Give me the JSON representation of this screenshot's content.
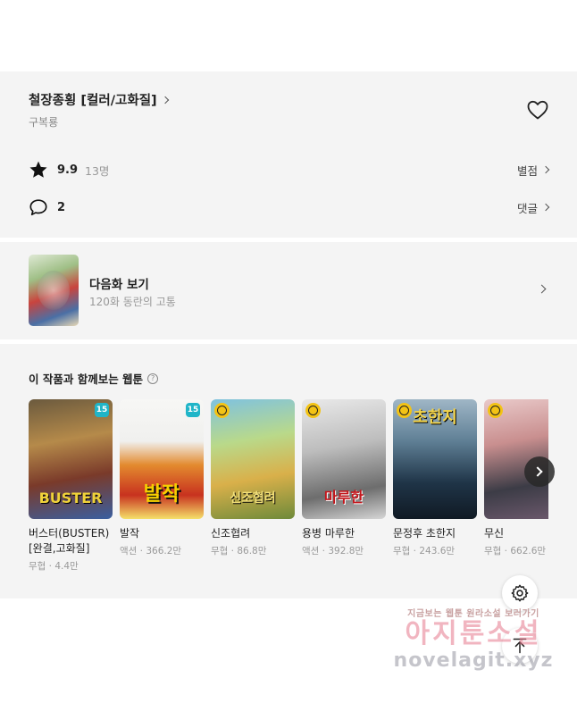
{
  "work": {
    "title": "철장종횡 [컬러/고화질]",
    "author": "구복룡",
    "rating": "9.9",
    "rating_count": "13명",
    "rating_link": "별점",
    "comment_count": "2",
    "comment_link": "댓글"
  },
  "next_episode": {
    "label": "다음화 보기",
    "subtitle": "120화 동란의 고통"
  },
  "recommendations": {
    "title": "이 작품과 함께보는 웹툰",
    "help_icon_text": "?",
    "items": [
      {
        "name": "버스터(BUSTER) [완결,고화질]",
        "meta": "무협 · 4.4만",
        "badge": "15",
        "badge_type": "age",
        "cover_text": "BUSTER"
      },
      {
        "name": "발작",
        "meta": "액션 · 366.2만",
        "badge": "15",
        "badge_type": "age",
        "cover_text": "발작"
      },
      {
        "name": "신조협려",
        "meta": "무협 · 86.8만",
        "badge": "",
        "badge_type": "wait",
        "cover_text": "신조협려"
      },
      {
        "name": "용병 마루한",
        "meta": "액션 · 392.8만",
        "badge": "",
        "badge_type": "wait",
        "cover_text": "마루한"
      },
      {
        "name": "문정후 초한지",
        "meta": "무협 · 243.6만",
        "badge": "",
        "badge_type": "wait",
        "cover_text": "초한지"
      },
      {
        "name": "무신",
        "meta": "무협 · 662.6만",
        "badge": "",
        "badge_type": "wait",
        "cover_text": ""
      }
    ]
  },
  "watermark": {
    "line1": "지금보는 웹툰 원라소설 보러가기",
    "line2": "아지툰소설",
    "line3": "novelagit.xyz"
  },
  "icons": {
    "heart": "heart-icon",
    "star": "star-icon",
    "comment": "comment-bubble-icon",
    "gear": "gear-icon",
    "scroll_top": "arrow-up-icon",
    "next": "chevron-right-icon"
  }
}
